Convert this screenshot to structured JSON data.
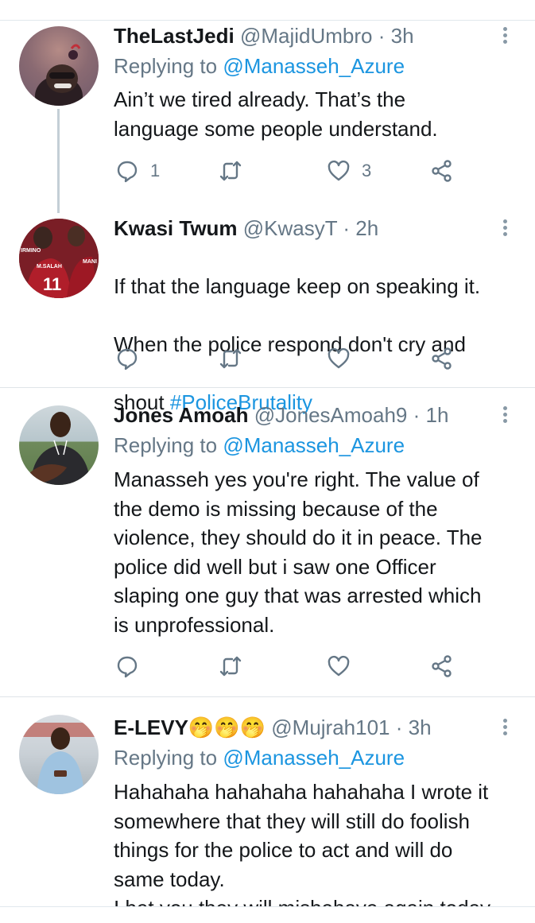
{
  "tweets": [
    {
      "name": "TheLastJedi",
      "handle": "@MajidUmbro",
      "time": "· 3h",
      "reply_prefix": "Replying to ",
      "reply_to": "@Manasseh_Azure",
      "text": "Ain’t we tired already. That’s the\nlanguage some people understand.",
      "replies": "1",
      "retweets": "",
      "likes": "3"
    },
    {
      "name": "Kwasi Twum",
      "handle": "@KwasyT",
      "time": "· 2h",
      "text_line1": "If that the language keep on speaking it.",
      "text_line2": "When the police respond don't cry and",
      "text_line3_prefix": "shout ",
      "hashtag": "#PoliceBrutality",
      "replies": "",
      "retweets": "",
      "likes": "",
      "avatar_text_top": "IRMINO",
      "avatar_text_name": "M.SALAH",
      "avatar_text_num": "11",
      "avatar_text_side": "MANI"
    },
    {
      "name": "Jones Amoah",
      "handle": "@JonesAmoah9",
      "time": "· 1h",
      "reply_prefix": "Replying to ",
      "reply_to": "@Manasseh_Azure",
      "text": "Manasseh yes you're right. The value of\nthe demo is missing because of the\nviolence, they should do it in peace.  The\npolice did well but i saw one Officer\nslaping one guy that was arrested which\nis unprofessional.",
      "replies": "",
      "retweets": "",
      "likes": ""
    },
    {
      "name": "E-LEVY🤭🤭🤭",
      "handle": "@Mujrah101",
      "time": "· 3h",
      "reply_prefix": "Replying to ",
      "reply_to": "@Manasseh_Azure",
      "text": "Hahahaha hahahaha hahahaha I wrote it\nsomewhere that they will still do foolish\nthings for the police to act and will do\nsame today.\nI bet you they will misbehave again today"
    }
  ],
  "colors": {
    "link": "#1b95e0",
    "muted": "#657786",
    "text": "#14171a",
    "divider": "#e1e8ed"
  },
  "icons": [
    "reply-icon",
    "retweet-icon",
    "like-icon",
    "share-icon",
    "more-options-icon"
  ]
}
